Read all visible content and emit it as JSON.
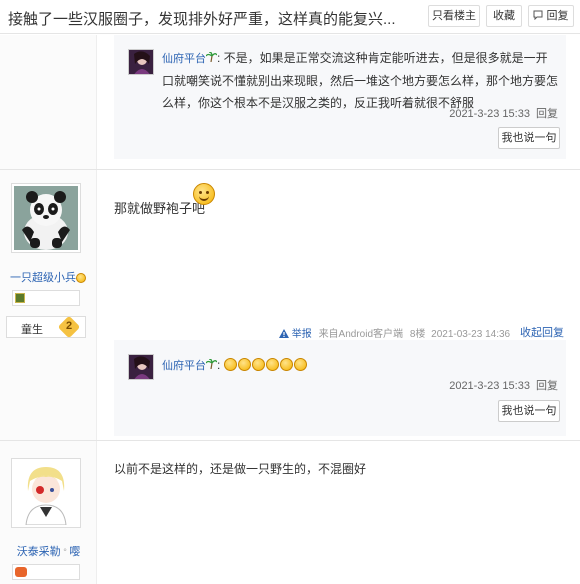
{
  "header": {
    "thread_title": "接触了一些汉服圈子，发现排外好严重，这样真的能复兴...",
    "only_op_label": "只看楼主",
    "favorite_label": "收藏",
    "reply_label": "回复"
  },
  "floor7": {
    "lzl": {
      "user": "仙府平台",
      "text": "不是，如果是正常交流这种肯定能听进去，但是很多就是一开口就嘲笑说不懂就别出来现眼，然后一堆这个地方要怎么样，那个地方要怎么样，你这个根本不是汉服之类的，反正我听着就很不舒服",
      "time": "2021-3-23 15:33",
      "reply": "回复",
      "say_btn": "我也说一句"
    }
  },
  "floor8": {
    "username": "一只超级小兵",
    "rank_title": "童生",
    "rank_level": "2",
    "content": "那就做野袍子吧",
    "report": "举报",
    "client": "来自Android客户端",
    "floor": "8楼",
    "datetime": "2021-03-23 14:36",
    "collapse": "收起回复",
    "lzl": {
      "user": "仙府平台",
      "time": "2021-3-23 15:33",
      "reply": "回复",
      "say_btn": "我也说一句"
    }
  },
  "floor9": {
    "username": "沃泰采勒",
    "username_suffix": "嘤",
    "content": "以前不是这样的，还是做一只野生的，不混圈好"
  },
  "colors": {
    "link": "#2d64b3",
    "rank_badge": "#f5c242"
  }
}
